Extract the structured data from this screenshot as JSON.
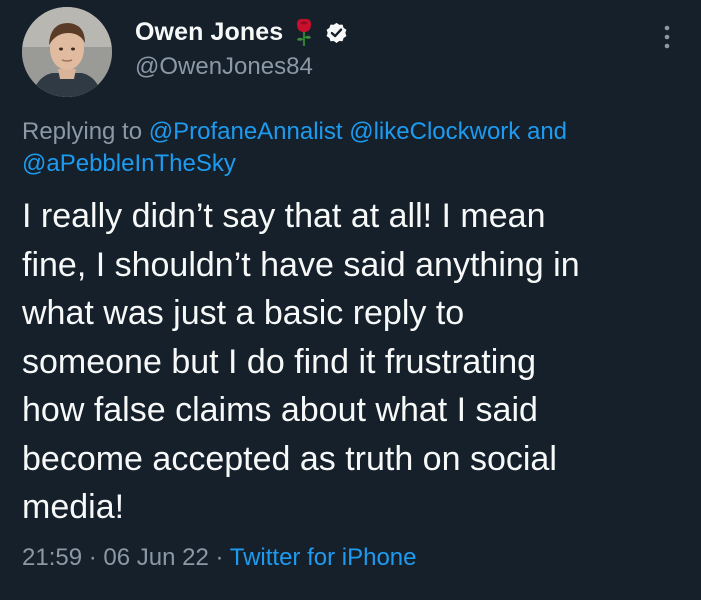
{
  "user": {
    "display_name": "Owen Jones",
    "handle": "@OwenJones84",
    "emoji_icon": "rose-icon",
    "verified_icon": "verified-badge-icon"
  },
  "reply": {
    "prefix": "Replying to",
    "mention_1": "@ProfaneAnnalist",
    "mention_2": "@likeClockwork",
    "conjunction": "and",
    "mention_3": "@aPebbleInTheSky"
  },
  "tweet": {
    "text": "I really didn’t say that at all! I mean\nfine, I shouldn’t have said anything in\nwhat was just a basic reply to\nsomeone but I do find it frustrating\nhow false claims about what I said\nbecome accepted as truth on social\nmedia!"
  },
  "meta": {
    "time": "21:59",
    "separator": "·",
    "date": "06 Jun 22",
    "source": "Twitter for iPhone"
  },
  "colors": {
    "background": "#15202b",
    "primary_text": "#f7f9f9",
    "secondary_text": "#8b98a5",
    "link": "#1d9bf0"
  }
}
